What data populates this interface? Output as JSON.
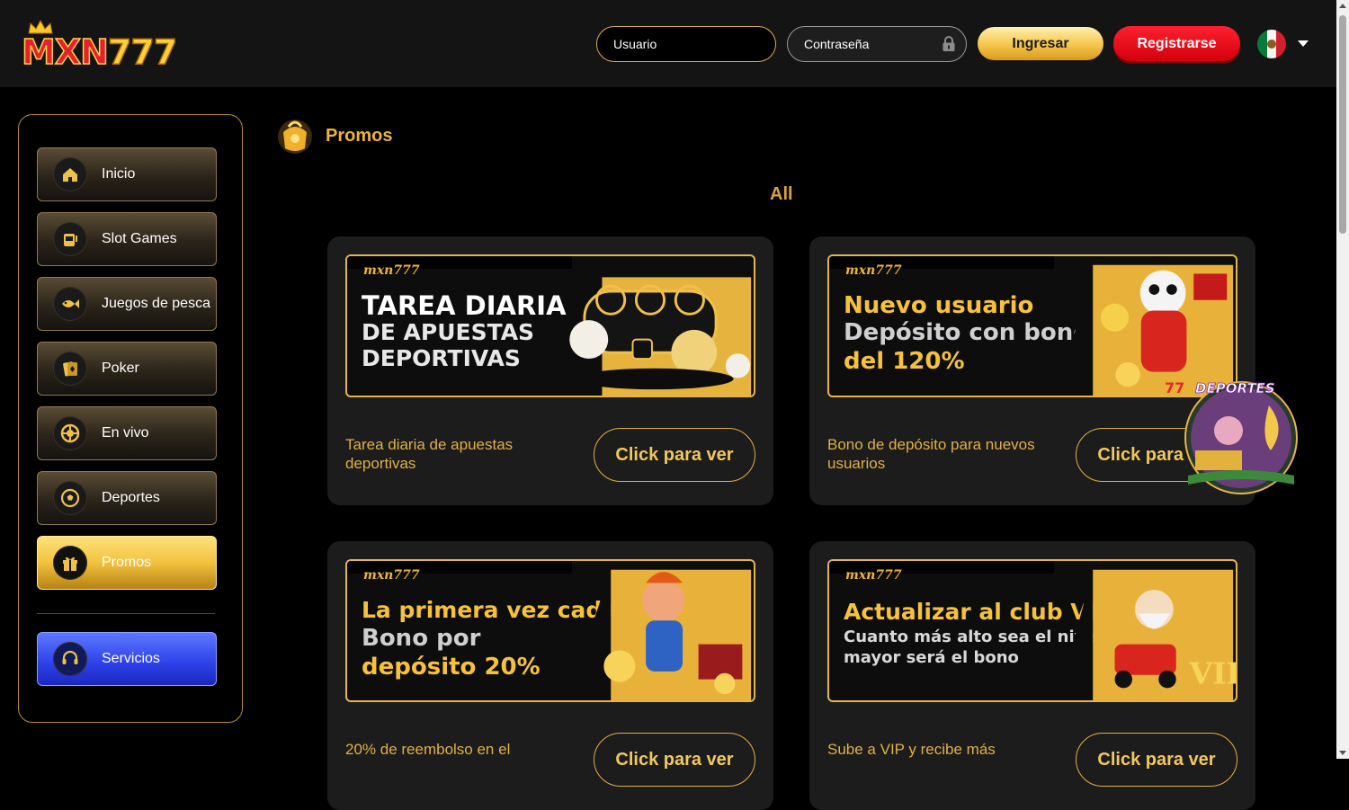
{
  "header": {
    "logo_text": "MXN777",
    "username_placeholder": "Usuario",
    "password_placeholder": "Contraseña",
    "login_label": "Ingresar",
    "register_label": "Registrarse",
    "language_flag": "mexico-flag-icon"
  },
  "sidebar": {
    "items": [
      {
        "label": "Inicio",
        "icon": "home-icon"
      },
      {
        "label": "Slot Games",
        "icon": "slot-machine-icon"
      },
      {
        "label": "Juegos de pesca",
        "icon": "fish-icon"
      },
      {
        "label": "Poker",
        "icon": "cards-icon"
      },
      {
        "label": "En vivo",
        "icon": "roulette-icon"
      },
      {
        "label": "Deportes",
        "icon": "soccer-ball-icon"
      },
      {
        "label": "Promos",
        "icon": "gift-icon",
        "active": true
      }
    ],
    "service": {
      "label": "Servicios",
      "icon": "headset-icon"
    }
  },
  "main": {
    "title": "Promos",
    "filter": "All",
    "cards": [
      {
        "banner_brand": "mxn777",
        "banner_lines": [
          "TAREA DIARIA",
          "DE APUESTAS",
          "DEPORTIVAS"
        ],
        "description": "Tarea diaria de apuestas deportivas",
        "button": "Click para ver"
      },
      {
        "banner_brand": "mxn777",
        "banner_lines": [
          "Nuevo usuario",
          "Depósito con bono",
          "del 120%"
        ],
        "description": "Bono de depósito para nuevos usuarios",
        "button": "Click para ver"
      },
      {
        "banner_brand": "mxn777",
        "banner_lines": [
          "La primera vez cada día",
          "Bono por",
          "depósito 20%"
        ],
        "description": "20% de reembolso en el",
        "button": "Click para ver"
      },
      {
        "banner_brand": "mxn777",
        "banner_lines": [
          "Actualizar al club VIP",
          "Cuanto más alto sea el nivel VIP",
          "mayor será el bono"
        ],
        "description": "Sube a VIP y recibe más",
        "button": "Click para ver"
      }
    ]
  },
  "float_badge": {
    "label": "77DEPORTES"
  },
  "colors": {
    "accent_gold": "#e1b046",
    "register_red": "#e8101e",
    "service_blue": "#3347ee",
    "background": "#000000"
  }
}
